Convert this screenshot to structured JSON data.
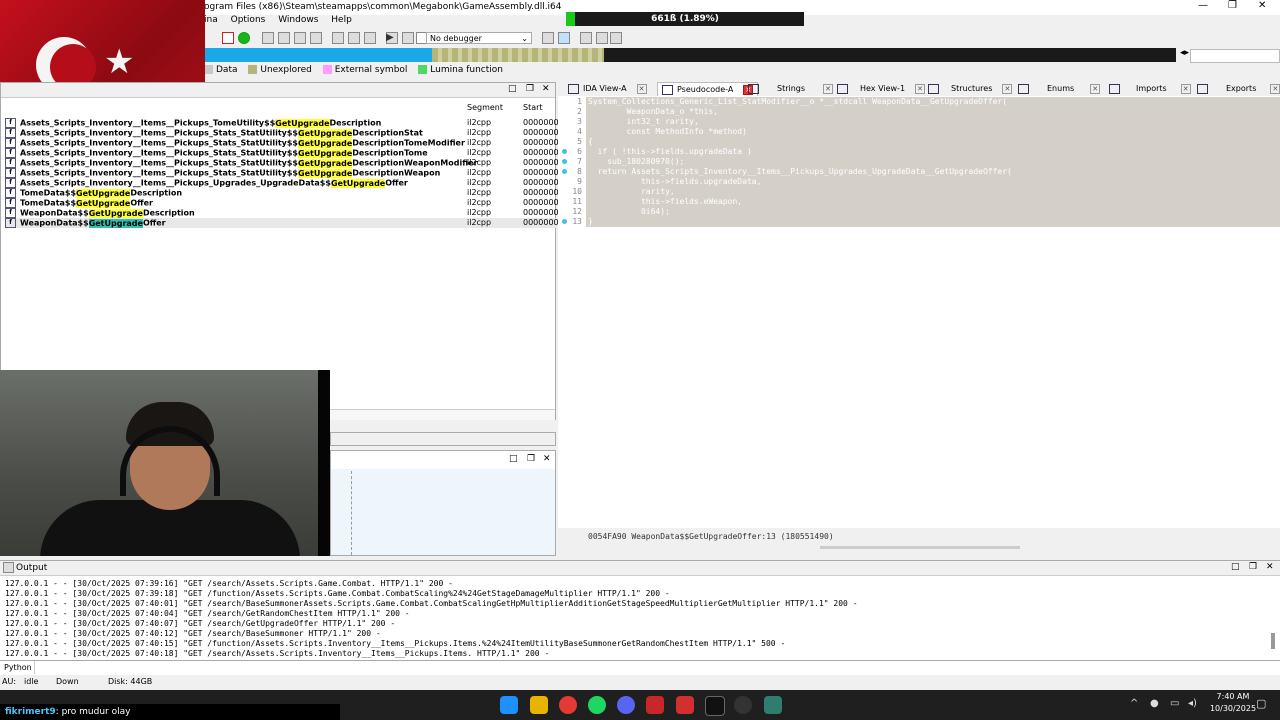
{
  "window": {
    "title": "ogram Files (x86)\\Steam\\steamapps\\common\\Megabonk\\GameAssembly.dll.i64",
    "controls": [
      "—",
      "❐",
      "✕"
    ]
  },
  "usage": {
    "label": "661ß (1.89%)",
    "fraction": 0.0189
  },
  "menu": [
    "ina",
    "Options",
    "Windows",
    "Help"
  ],
  "debugger": {
    "selected": "No debugger"
  },
  "legend": [
    {
      "label": "Data",
      "color": "#c8c8c8"
    },
    {
      "label": "Unexplored",
      "color": "#b5b57a"
    },
    {
      "label": "External symbol",
      "color": "#ff9cff"
    },
    {
      "label": "Lumina function",
      "color": "#4cd964"
    }
  ],
  "functions": {
    "col_segment": "Segment",
    "col_start": "Start",
    "rows": [
      {
        "pre": "Assets_Scripts_Inventory__Items__Pickups_TomeUtility$$",
        "match": "GetUpgrade",
        "post": "Description",
        "segment": "il2cpp",
        "start": "0000000"
      },
      {
        "pre": "Assets_Scripts_Inventory__Items__Pickups_Stats_StatUtility$$",
        "match": "GetUpgrade",
        "post": "DescriptionStat",
        "segment": "il2cpp",
        "start": "0000000"
      },
      {
        "pre": "Assets_Scripts_Inventory__Items__Pickups_Stats_StatUtility$$",
        "match": "GetUpgrade",
        "post": "DescriptionTomeModifier",
        "segment": "il2cpp",
        "start": "0000000"
      },
      {
        "pre": "Assets_Scripts_Inventory__Items__Pickups_Stats_StatUtility$$",
        "match": "GetUpgrade",
        "post": "DescriptionTome",
        "segment": "il2cpp",
        "start": "0000000"
      },
      {
        "pre": "Assets_Scripts_Inventory__Items__Pickups_Stats_StatUtility$$",
        "match": "GetUpgrade",
        "post": "DescriptionWeaponModifier",
        "segment": "il2cpp",
        "start": "0000000"
      },
      {
        "pre": "Assets_Scripts_Inventory__Items__Pickups_Stats_StatUtility$$",
        "match": "GetUpgrade",
        "post": "DescriptionWeapon",
        "segment": "il2cpp",
        "start": "0000000"
      },
      {
        "pre": "Assets_Scripts_Inventory__Items__Pickups_Upgrades_UpgradeData$$",
        "match": "GetUpgrade",
        "post": "Offer",
        "segment": "il2cpp",
        "start": "0000000"
      },
      {
        "pre": "TomeData$$",
        "match": "GetUpgrade",
        "post": "Description",
        "segment": "il2cpp",
        "start": "0000000"
      },
      {
        "pre": "TomeData$$",
        "match": "GetUpgrade",
        "post": "Offer",
        "segment": "il2cpp",
        "start": "0000000"
      },
      {
        "pre": "WeaponData$$",
        "match": "GetUpgrade",
        "post": "Description",
        "segment": "il2cpp",
        "start": "0000000"
      },
      {
        "pre": "WeaponData$$",
        "match": "GetUpgrade",
        "post": "Offer",
        "segment": "il2cpp",
        "start": "0000000"
      }
    ]
  },
  "tabs": [
    {
      "label": "IDA View-A"
    },
    {
      "label": "Pseudocode-A"
    },
    {
      "label": "Strings"
    },
    {
      "label": "Hex View-1"
    },
    {
      "label": "Structures"
    },
    {
      "label": "Enums"
    },
    {
      "label": "Imports"
    },
    {
      "label": "Exports"
    }
  ],
  "code": {
    "lines": [
      "System_Collections_Generic_List_StatModifier__o *__stdcall WeaponData__GetUpgradeOffer(",
      "        WeaponData_o *this,",
      "        int32_t rarity,",
      "        const MethodInfo *method)",
      "{",
      "  if ( !this->fields.upgradeData )",
      "    sub_180280970();",
      "  return Assets_Scripts_Inventory__Items__Pickups_Upgrades_UpgradeData__GetUpgradeOffer(",
      "           this->fields.upgradeData,",
      "           rarity,",
      "           this->fields.eWeapon,",
      "           0i64);",
      "}"
    ],
    "line_numbers": [
      "1",
      "2",
      "3",
      "4",
      "5",
      "6",
      "7",
      "8",
      "9",
      "10",
      "11",
      "12",
      "13"
    ],
    "status": "0054FA90 WeaponData$$GetUpgradeOffer:13 (180551490)"
  },
  "output": {
    "title": "Output",
    "lines": [
      "127.0.0.1 - - [30/Oct/2025 07:39:16] \"GET /search/Assets.Scripts.Game.Combat. HTTP/1.1\" 200 -",
      "127.0.0.1 - - [30/Oct/2025 07:39:18] \"GET /function/Assets.Scripts.Game.Combat.CombatScaling%24%24GetStageDamageMultiplier HTTP/1.1\" 200 -",
      "127.0.0.1 - - [30/Oct/2025 07:40:01] \"GET /search/BaseSummonerAssets.Scripts.Game.Combat.CombatScalingGetHpMultiplierAdditionGetStageSpeedMultiplierGetMultiplier HTTP/1.1\" 200 -",
      "127.0.0.1 - - [30/Oct/2025 07:40:04] \"GET /search/GetRandomChestItem HTTP/1.1\" 200 -",
      "127.0.0.1 - - [30/Oct/2025 07:40:07] \"GET /search/GetUpgradeOffer HTTP/1.1\" 200 -",
      "127.0.0.1 - - [30/Oct/2025 07:40:12] \"GET /search/BaseSummoner HTTP/1.1\" 200 -",
      "127.0.0.1 - - [30/Oct/2025 07:40:15] \"GET /function/Assets.Scripts.Inventory__Items__Pickups.Items.%24%24ItemUtilityBaseSummonerGetRandomChestItem HTTP/1.1\" 500 -",
      "127.0.0.1 - - [30/Oct/2025 07:40:18] \"GET /search/Assets.Scripts.Inventory__Items__Pickups.Items. HTTP/1.1\" 200 -"
    ],
    "lang": "Python"
  },
  "status": {
    "au": "AU:",
    "au_state": "idle",
    "direction": "Down",
    "disk": "Disk: 44GB"
  },
  "taskbar": {
    "time": "7:40 AM",
    "date": "10/30/2025"
  },
  "chat": {
    "user": "fikrimert9",
    "message": ": pro mudur olay"
  }
}
